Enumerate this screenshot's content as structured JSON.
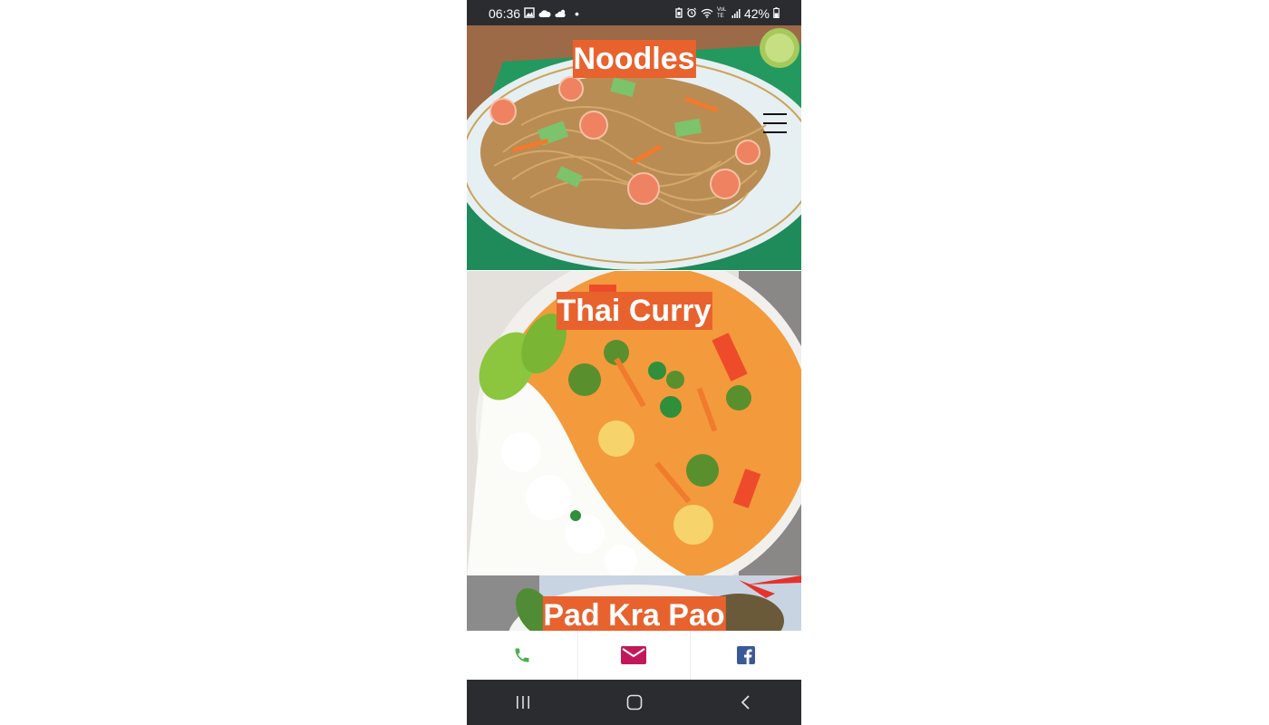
{
  "status_bar": {
    "time": "06:36",
    "battery": "42%",
    "dot": "•",
    "lte_label": "VoLTE"
  },
  "cards": [
    {
      "title": "Noodles"
    },
    {
      "title": "Thai Curry"
    },
    {
      "title": "Pad Kra Pao"
    }
  ],
  "icons": {
    "menu": "hamburger-menu-icon",
    "phone": "phone-icon",
    "mail": "mail-icon",
    "facebook": "facebook-icon"
  },
  "colors": {
    "title_bg": "#e8622e",
    "phone": "#4caf50",
    "mail": "#c2185b",
    "facebook": "#3b5998"
  }
}
